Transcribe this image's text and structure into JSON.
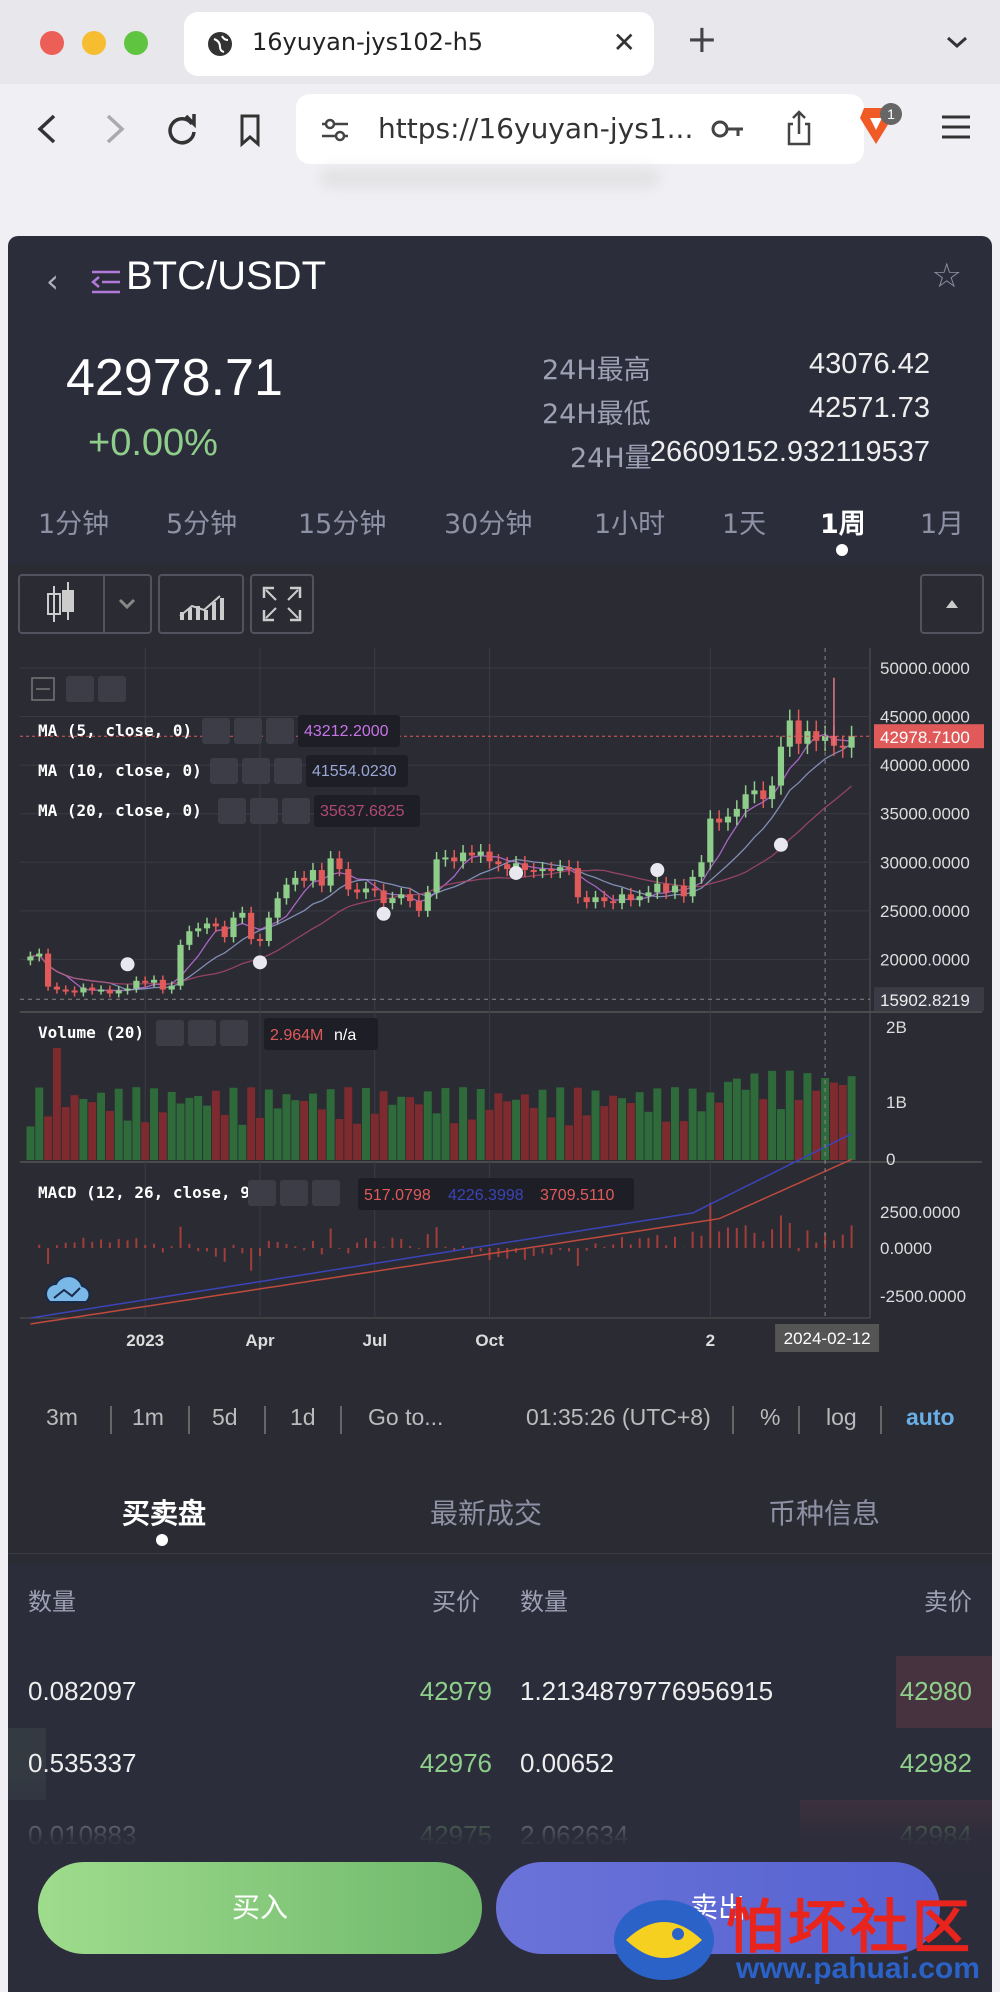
{
  "browser": {
    "tab_title": "16yuyan-jys102-h5",
    "url": "https://16yuyan-jys1...",
    "shield_badge": "1"
  },
  "market": {
    "pair": "BTC/USDT",
    "price": "42978.71",
    "change": "+0.00%",
    "high_label": "24H最高",
    "high": "43076.42",
    "low_label": "24H最低",
    "low": "42571.73",
    "vol_label": "24H量",
    "vol": "26609152.932119537"
  },
  "periods": [
    "1分钟",
    "5分钟",
    "15分钟",
    "30分钟",
    "1小时",
    "1天",
    "1周",
    "1月"
  ],
  "active_period": "1周",
  "chart_data": {
    "type": "candlestick",
    "y_ticks": [
      "50000.0000",
      "45000.0000",
      "40000.0000",
      "35000.0000",
      "30000.0000",
      "25000.0000",
      "20000.0000"
    ],
    "ylim": [
      15000,
      50000
    ],
    "last_price_label": "42978.7100",
    "crosshair_price_label": "15902.8219",
    "crosshair_date_label": "2024-02-12",
    "x_ticks": [
      "2023",
      "Apr",
      "Jul",
      "Oct",
      "2"
    ],
    "closes": [
      20300,
      20600,
      17200,
      16900,
      16800,
      16600,
      17100,
      16800,
      16900,
      16500,
      16800,
      17000,
      17800,
      17600,
      17900,
      16900,
      17300,
      21500,
      22900,
      23200,
      23700,
      23400,
      22300,
      24300,
      24800,
      22100,
      21900,
      24300,
      26300,
      27700,
      28400,
      28100,
      29200,
      27600,
      30400,
      29300,
      27200,
      26900,
      27300,
      27100,
      25800,
      26300,
      26700,
      26000,
      25000,
      26900,
      30300,
      30500,
      30100,
      31000,
      30700,
      31100,
      30100,
      29800,
      29300,
      29900,
      29200,
      29100,
      29300,
      29100,
      29500,
      29400,
      26400,
      25900,
      26400,
      26000,
      25800,
      26700,
      26100,
      26500,
      26900,
      27800,
      26900,
      27600,
      26500,
      28500,
      30000,
      34500,
      34100,
      34700,
      35500,
      37000,
      37400,
      36500,
      37900,
      41900,
      44600,
      42200,
      43500,
      42500,
      43000,
      42000,
      41800,
      42978
    ],
    "ma_lines": [
      {
        "name": "MA (5, close, 0)",
        "value": "43212.2000",
        "color": "#c774e8"
      },
      {
        "name": "MA (10, close, 0)",
        "value": "41554.0230",
        "color": "#9aa6d6"
      },
      {
        "name": "MA (20, close, 0)",
        "value": "35637.6825",
        "color": "#b04a70"
      }
    ],
    "volume": {
      "name": "Volume (20)",
      "value": "2.964M",
      "extra": "n/a",
      "y_ticks": [
        "2B",
        "1B",
        "0"
      ]
    },
    "macd": {
      "name": "MACD (12, 26, close, 9)",
      "values": [
        "517.0798",
        "4226.3998",
        "3709.5110"
      ],
      "y_ticks": [
        "2500.0000",
        "0.0000",
        "-2500.0000"
      ]
    }
  },
  "chart_bottom": {
    "ranges": [
      "3m",
      "1m",
      "5d",
      "1d"
    ],
    "goto": "Go to...",
    "time": "01:35:26 (UTC+8)",
    "percent": "%",
    "log": "log",
    "auto": "auto"
  },
  "order_tabs": [
    "买卖盘",
    "最新成交",
    "币种信息"
  ],
  "order_head": {
    "qty": "数量",
    "bid": "买价",
    "qty2": "数量",
    "ask": "卖价"
  },
  "orders": [
    {
      "bid_qty": "0.082097",
      "bid": "42979",
      "ask_qty": "1.2134879776956915",
      "ask": "42980",
      "bid_depth": 0.0,
      "ask_depth": 0.2
    },
    {
      "bid_qty": "0.535337",
      "bid": "42976",
      "ask_qty": "0.00652",
      "ask": "42982",
      "bid_depth": 0.08,
      "ask_depth": 0.0
    },
    {
      "bid_qty": "0.010883",
      "bid": "42975",
      "ask_qty": "2.062634",
      "ask": "42984",
      "bid_depth": 0.0,
      "ask_depth": 0.4
    }
  ],
  "buttons": {
    "buy": "买入",
    "sell": "卖出"
  },
  "watermark": {
    "text": "怕坏社区",
    "url": "www.pahuai.com"
  },
  "colors": {
    "up": "#8fce8a",
    "down": "#e05a5a",
    "accent": "#5562d0"
  }
}
